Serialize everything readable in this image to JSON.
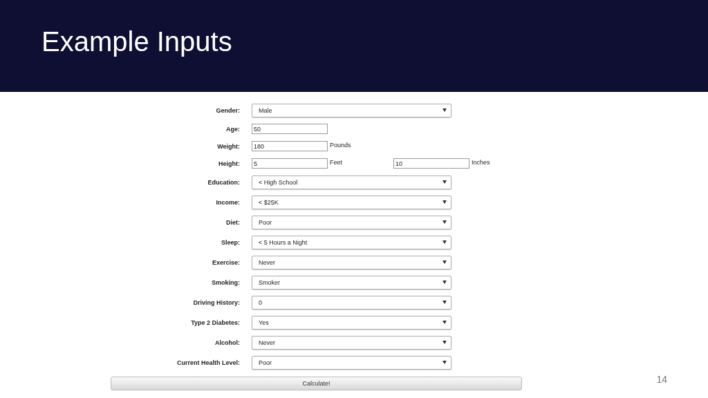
{
  "slide": {
    "title": "Example Inputs",
    "page_number": "14"
  },
  "form": {
    "fields": [
      {
        "kind": "select",
        "label": "Gender:",
        "value": "Male"
      },
      {
        "kind": "text",
        "label": "Age:",
        "value": "50"
      },
      {
        "kind": "text",
        "label": "Weight:",
        "value": "180",
        "unit": "Pounds"
      },
      {
        "kind": "pair",
        "label": "Height:",
        "parts": [
          {
            "value": "5",
            "unit": "Feet"
          },
          {
            "value": "10",
            "unit": "Inches"
          }
        ]
      },
      {
        "kind": "select",
        "label": "Education:",
        "value": "< High School"
      },
      {
        "kind": "select",
        "label": "Income:",
        "value": "< $25K"
      },
      {
        "kind": "select",
        "label": "Diet:",
        "value": "Poor"
      },
      {
        "kind": "select",
        "label": "Sleep:",
        "value": "< 5 Hours a Night"
      },
      {
        "kind": "select",
        "label": "Exercise:",
        "value": "Never"
      },
      {
        "kind": "select",
        "label": "Smoking:",
        "value": "Smoker"
      },
      {
        "kind": "select",
        "label": "Driving History:",
        "value": "0"
      },
      {
        "kind": "select",
        "label": "Type 2 Diabetes:",
        "value": "Yes"
      },
      {
        "kind": "select",
        "label": "Alcohol:",
        "value": "Never"
      },
      {
        "kind": "select",
        "label": "Current Health Level:",
        "value": "Poor"
      }
    ],
    "submit": "Calculate!"
  }
}
